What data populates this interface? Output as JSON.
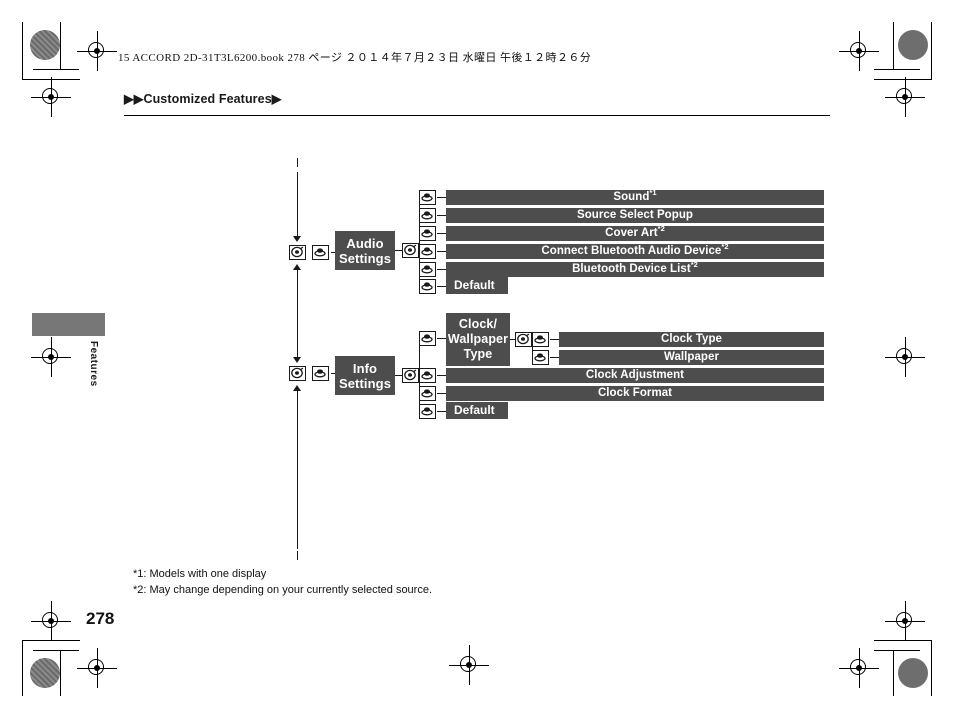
{
  "header": {
    "book_line": "15 ACCORD 2D-31T3L6200.book   278 ページ   ２０１４年７月２３日   水曜日   午後１２時２６分"
  },
  "breadcrumb": {
    "text": "Customized Features",
    "lead_marks": "▶▶",
    "trail_mark": "▶"
  },
  "side_tab": {
    "label": "Features"
  },
  "page": {
    "number": "278"
  },
  "footnotes": {
    "line1": "*1: Models with one display",
    "line2": "*2: May change depending on your currently selected source."
  },
  "diagram": {
    "branches": [
      {
        "id": "audio-settings",
        "node_line1": "Audio",
        "node_line2": "Settings",
        "items": [
          {
            "label": "Sound",
            "sup": "*1",
            "style": "bar"
          },
          {
            "label": "Source Select Popup",
            "sup": "",
            "style": "bar"
          },
          {
            "label": "Cover Art",
            "sup": "*2",
            "style": "bar"
          },
          {
            "label": "Connect Bluetooth Audio Device",
            "sup": "*2",
            "style": "bar"
          },
          {
            "label": "Bluetooth Device List",
            "sup": "*2",
            "style": "bar"
          },
          {
            "label": "Default",
            "sup": "",
            "style": "chip"
          }
        ]
      },
      {
        "id": "info-settings",
        "node_line1": "Info",
        "node_line2": "Settings",
        "items": [
          {
            "label": "Clock/ Wallpaper Type",
            "sup": "",
            "style": "group"
          },
          {
            "label": "Clock Adjustment",
            "sup": "",
            "style": "bar"
          },
          {
            "label": "Clock Format",
            "sup": "",
            "style": "bar"
          },
          {
            "label": "Default",
            "sup": "",
            "style": "chip"
          }
        ],
        "subgroup": {
          "title_line1": "Clock/",
          "title_line2": "Wallpaper",
          "title_line3": "Type",
          "items": [
            {
              "label": "Clock Type",
              "sup": ""
            },
            {
              "label": "Wallpaper",
              "sup": ""
            }
          ]
        }
      }
    ],
    "icons": {
      "dial": "rotary-dial-icon",
      "enter": "enter-button-icon"
    }
  },
  "colors": {
    "node_fill": "#4d4d4d",
    "side_tab_fill": "#777777",
    "text_on_node": "#ffffff",
    "line": "#1a1a1a"
  }
}
